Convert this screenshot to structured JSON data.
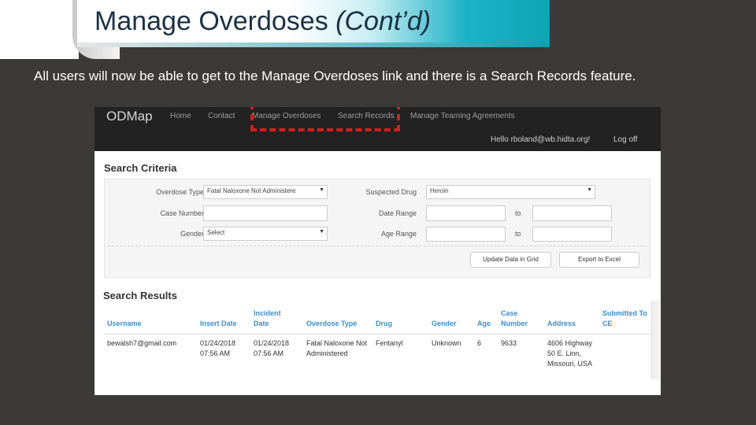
{
  "slide": {
    "title_main": "Manage Overdoses ",
    "title_italic": "(Cont’d)",
    "subtitle": "All users will now be able to get to the Manage Overdoses link and there is a Search Records feature."
  },
  "app": {
    "brand": "ODMap",
    "nav": [
      "Home",
      "Contact",
      "Manage Overdoses",
      "Search Records",
      "Manage Teaming Agreements"
    ],
    "user_greeting": "Hello rboland@wb.hidta.org!",
    "logoff": "Log off",
    "criteria": {
      "title": "Search Criteria",
      "overdose_type_label": "Overdose Type",
      "overdose_type_value": "Fatal Naloxone Not Administere",
      "case_number_label": "Case Number",
      "case_number_value": "",
      "gender_label": "Gender",
      "gender_value": "Select",
      "suspected_drug_label": "Suspected Drug",
      "suspected_drug_value": "Heroin",
      "date_range_label": "Date Range",
      "age_range_label": "Age Range",
      "to_label": "to",
      "update_button": "Update Data in Grid",
      "export_button": "Export to Excel"
    },
    "results": {
      "title": "Search Results",
      "columns": [
        "Username",
        "Insert Date",
        "Incident Date",
        "Overdose Type",
        "Drug",
        "Gender",
        "Age",
        "Case Number",
        "Address",
        "Submitted To CE"
      ],
      "row": {
        "username": "bewalsh7@gmail.com",
        "insert_date": "01/24/2018 07:56 AM",
        "incident_date": "01/24/2018 07:56 AM",
        "overdose_type": "Fatal Naloxone Not Administered",
        "drug": "Fentanyl",
        "gender": "Unknown",
        "age": "6",
        "case_number": "9633",
        "address": "4606 Highway 50 E. Linn, Missouri, USA",
        "submitted": ""
      }
    }
  },
  "colors": {
    "slide_bg": "#3b3a38",
    "title_text": "#1b3145",
    "ribbon_accent": "#0fa3b6",
    "highlight_dash": "#d21f1f",
    "nav_bg": "#222222",
    "table_header": "#3a8fcf"
  }
}
